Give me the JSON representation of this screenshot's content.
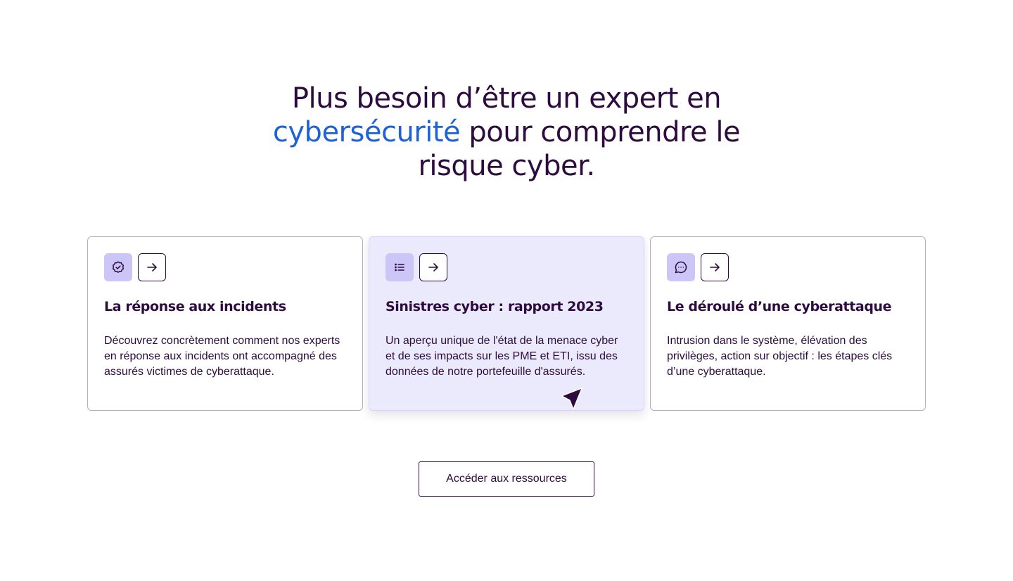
{
  "headline": {
    "line1": "Plus besoin d’être un expert en",
    "accent": "cybersécurité",
    "line2_rest": " pour comprendre le",
    "line3": "risque cyber."
  },
  "colors": {
    "text": "#2d0b3e",
    "accent": "#1f62d6",
    "icon_badge": "#cbc6f7",
    "card_active_bg": "#ebeafc"
  },
  "cards": [
    {
      "icon": "badge-check-icon",
      "title": "La réponse aux incidents",
      "description": "Découvrez concrètement comment nos experts en réponse aux incidents ont accompagné des assurés victimes de cyberattaque.",
      "active": false
    },
    {
      "icon": "list-icon",
      "title": "Sinistres cyber : rapport 2023",
      "description": "Un aperçu unique de l'état de la menace cyber et de ses impacts sur les PME et ETI, issu des données de notre portefeuille d'assurés.",
      "active": true
    },
    {
      "icon": "chat-bubble-icon",
      "title": "Le déroulé d’une cyberattaque",
      "description": "Intrusion dans le système, élévation des privilèges, action sur objectif : les étapes clés d’une cyberattaque.",
      "active": false
    }
  ],
  "cta": {
    "label": "Accéder aux ressources"
  }
}
